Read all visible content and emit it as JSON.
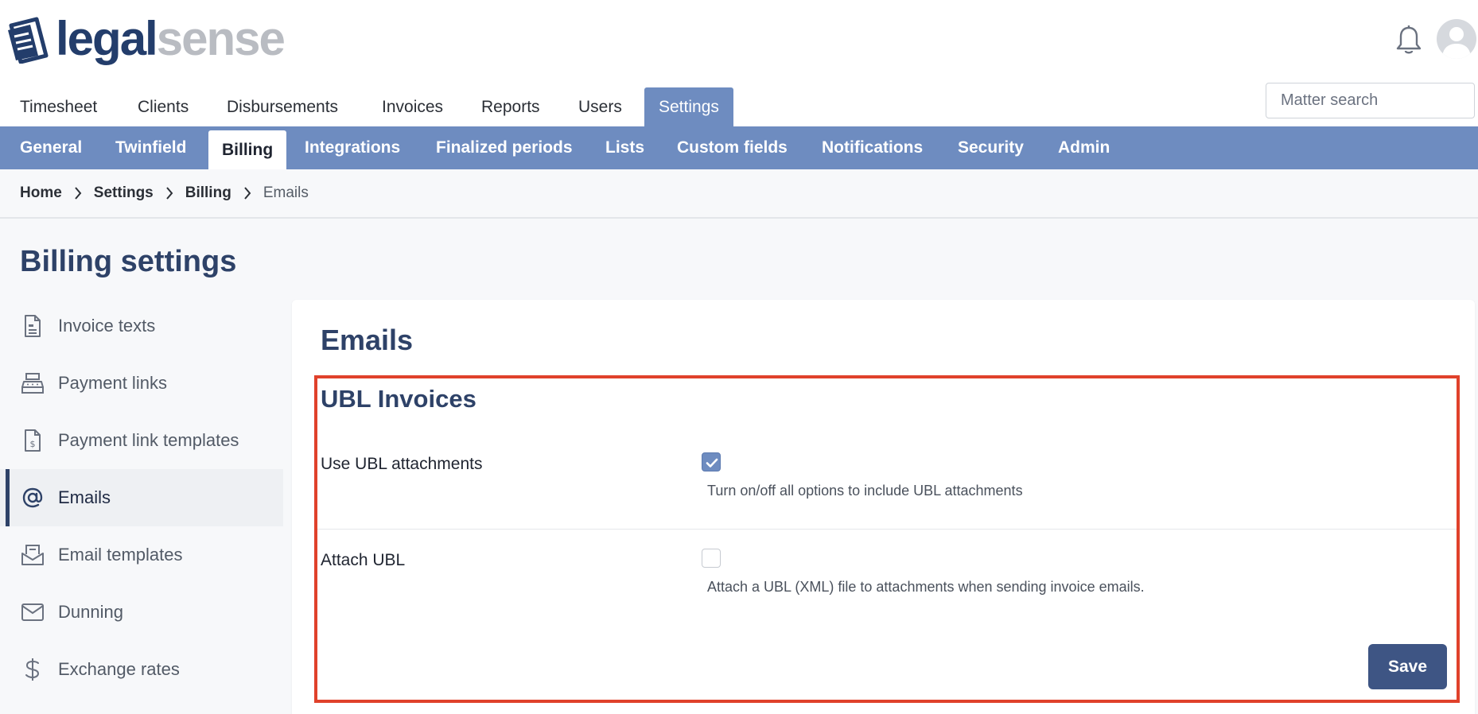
{
  "brand": {
    "name_part1": "legal",
    "name_part2": "sense"
  },
  "header": {
    "bell_icon": "bell-icon",
    "avatar_icon": "user-avatar-icon"
  },
  "top_nav": {
    "items": [
      {
        "label": "Timesheet",
        "active": false
      },
      {
        "label": "Clients",
        "active": false
      },
      {
        "label": "Disbursements",
        "active": false
      },
      {
        "label": "Invoices",
        "active": false
      },
      {
        "label": "Reports",
        "active": false
      },
      {
        "label": "Users",
        "active": false
      },
      {
        "label": "Settings",
        "active": true
      }
    ],
    "search_placeholder": "Matter search"
  },
  "sub_nav": {
    "items": [
      {
        "label": "General",
        "active": false
      },
      {
        "label": "Twinfield",
        "active": false
      },
      {
        "label": "Billing",
        "active": true
      },
      {
        "label": "Integrations",
        "active": false
      },
      {
        "label": "Finalized periods",
        "active": false
      },
      {
        "label": "Lists",
        "active": false
      },
      {
        "label": "Custom fields",
        "active": false
      },
      {
        "label": "Notifications",
        "active": false
      },
      {
        "label": "Security",
        "active": false
      },
      {
        "label": "Admin",
        "active": false
      }
    ]
  },
  "breadcrumb": [
    "Home",
    "Settings",
    "Billing",
    "Emails"
  ],
  "page": {
    "title": "Billing settings"
  },
  "side_menu": {
    "items": [
      {
        "label": "Invoice texts",
        "icon": "document-icon",
        "active": false
      },
      {
        "label": "Payment links",
        "icon": "cash-register-icon",
        "active": false
      },
      {
        "label": "Payment link templates",
        "icon": "invoice-dollar-icon",
        "active": false
      },
      {
        "label": "Emails",
        "icon": "at-sign-icon",
        "active": true
      },
      {
        "label": "Email templates",
        "icon": "envelope-tray-icon",
        "active": false
      },
      {
        "label": "Dunning",
        "icon": "envelope-icon",
        "active": false
      },
      {
        "label": "Exchange rates",
        "icon": "dollar-icon",
        "active": false
      }
    ]
  },
  "content": {
    "title": "Emails",
    "section_title": "UBL Invoices",
    "fields": [
      {
        "label": "Use UBL attachments",
        "checked": true,
        "help": "Turn on/off all options to include UBL attachments"
      },
      {
        "label": "Attach UBL",
        "checked": false,
        "help": "Attach a UBL (XML) file to attachments when sending invoice emails."
      }
    ],
    "save_label": "Save"
  },
  "colors": {
    "accent": "#6e8cc0",
    "brand_dark": "#2e4268",
    "highlight": "#e0412b",
    "button": "#3e5584"
  }
}
